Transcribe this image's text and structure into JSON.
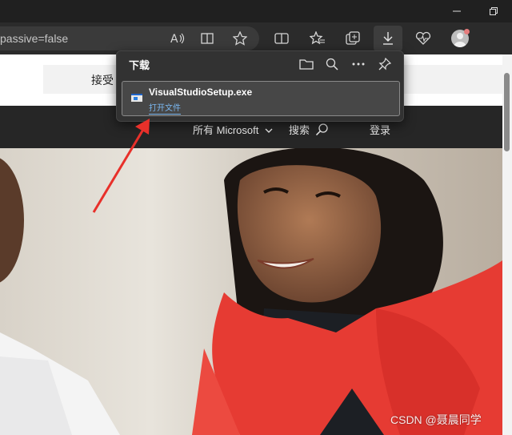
{
  "window": {
    "minimize_glyph": "—",
    "restore_glyph": "❐"
  },
  "toolbar": {
    "url_fragment": "passive=false",
    "icons": [
      "read-aloud-icon",
      "immersive-reader-icon",
      "favorite-star-icon",
      "split-screen-icon",
      "favorites-icon",
      "collections-icon",
      "downloads-icon",
      "browser-essentials-icon",
      "profile-avatar-icon"
    ]
  },
  "page": {
    "cookie_text": "接受",
    "nav": {
      "all_microsoft": "所有 Microsoft",
      "search": "搜索",
      "sign_in": "登录"
    }
  },
  "downloads": {
    "title": "下载",
    "item": {
      "file_name": "VisualStudioSetup.exe",
      "action": "打开文件"
    }
  },
  "annotation": {
    "arrow_color": "#e8302a"
  },
  "watermark": "CSDN @聂晨同学"
}
